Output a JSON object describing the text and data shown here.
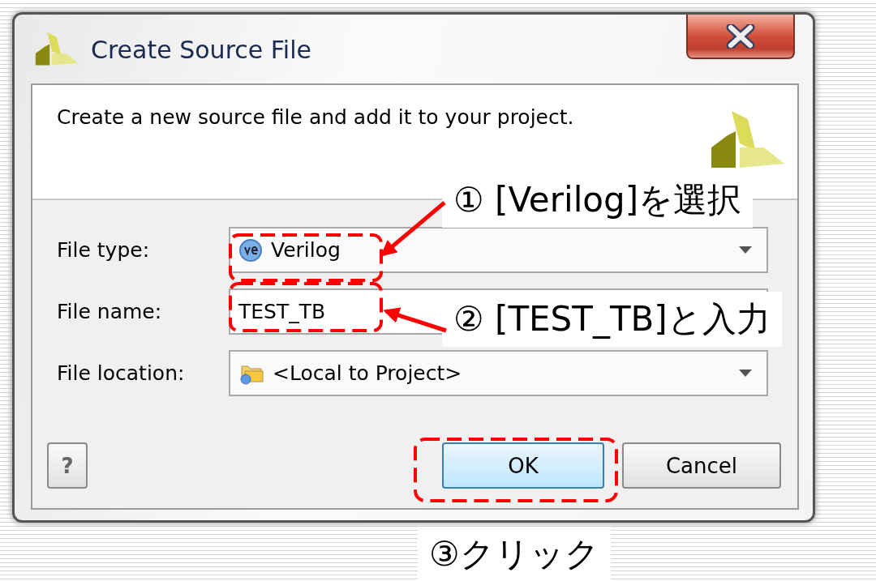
{
  "window": {
    "title": "Create Source File"
  },
  "description": "Create a new source file and add it to your project.",
  "fields": [
    {
      "kind": "filetype",
      "label": "File type:",
      "value": "Verilog"
    },
    {
      "kind": "text",
      "label": "File name:",
      "value": "TEST_TB"
    },
    {
      "kind": "location",
      "label": "File location:",
      "value": "<Local to Project>"
    }
  ],
  "buttons": [
    {
      "kind": "help",
      "label": "?",
      "default": false
    },
    {
      "kind": "action",
      "label": "OK",
      "default": true
    },
    {
      "kind": "action",
      "label": "Cancel",
      "default": false
    }
  ],
  "annotations": [
    {
      "text": "① [Verilog]を選択"
    },
    {
      "text": "② [TEST_TB]と入力"
    },
    {
      "text": "③クリック"
    }
  ]
}
